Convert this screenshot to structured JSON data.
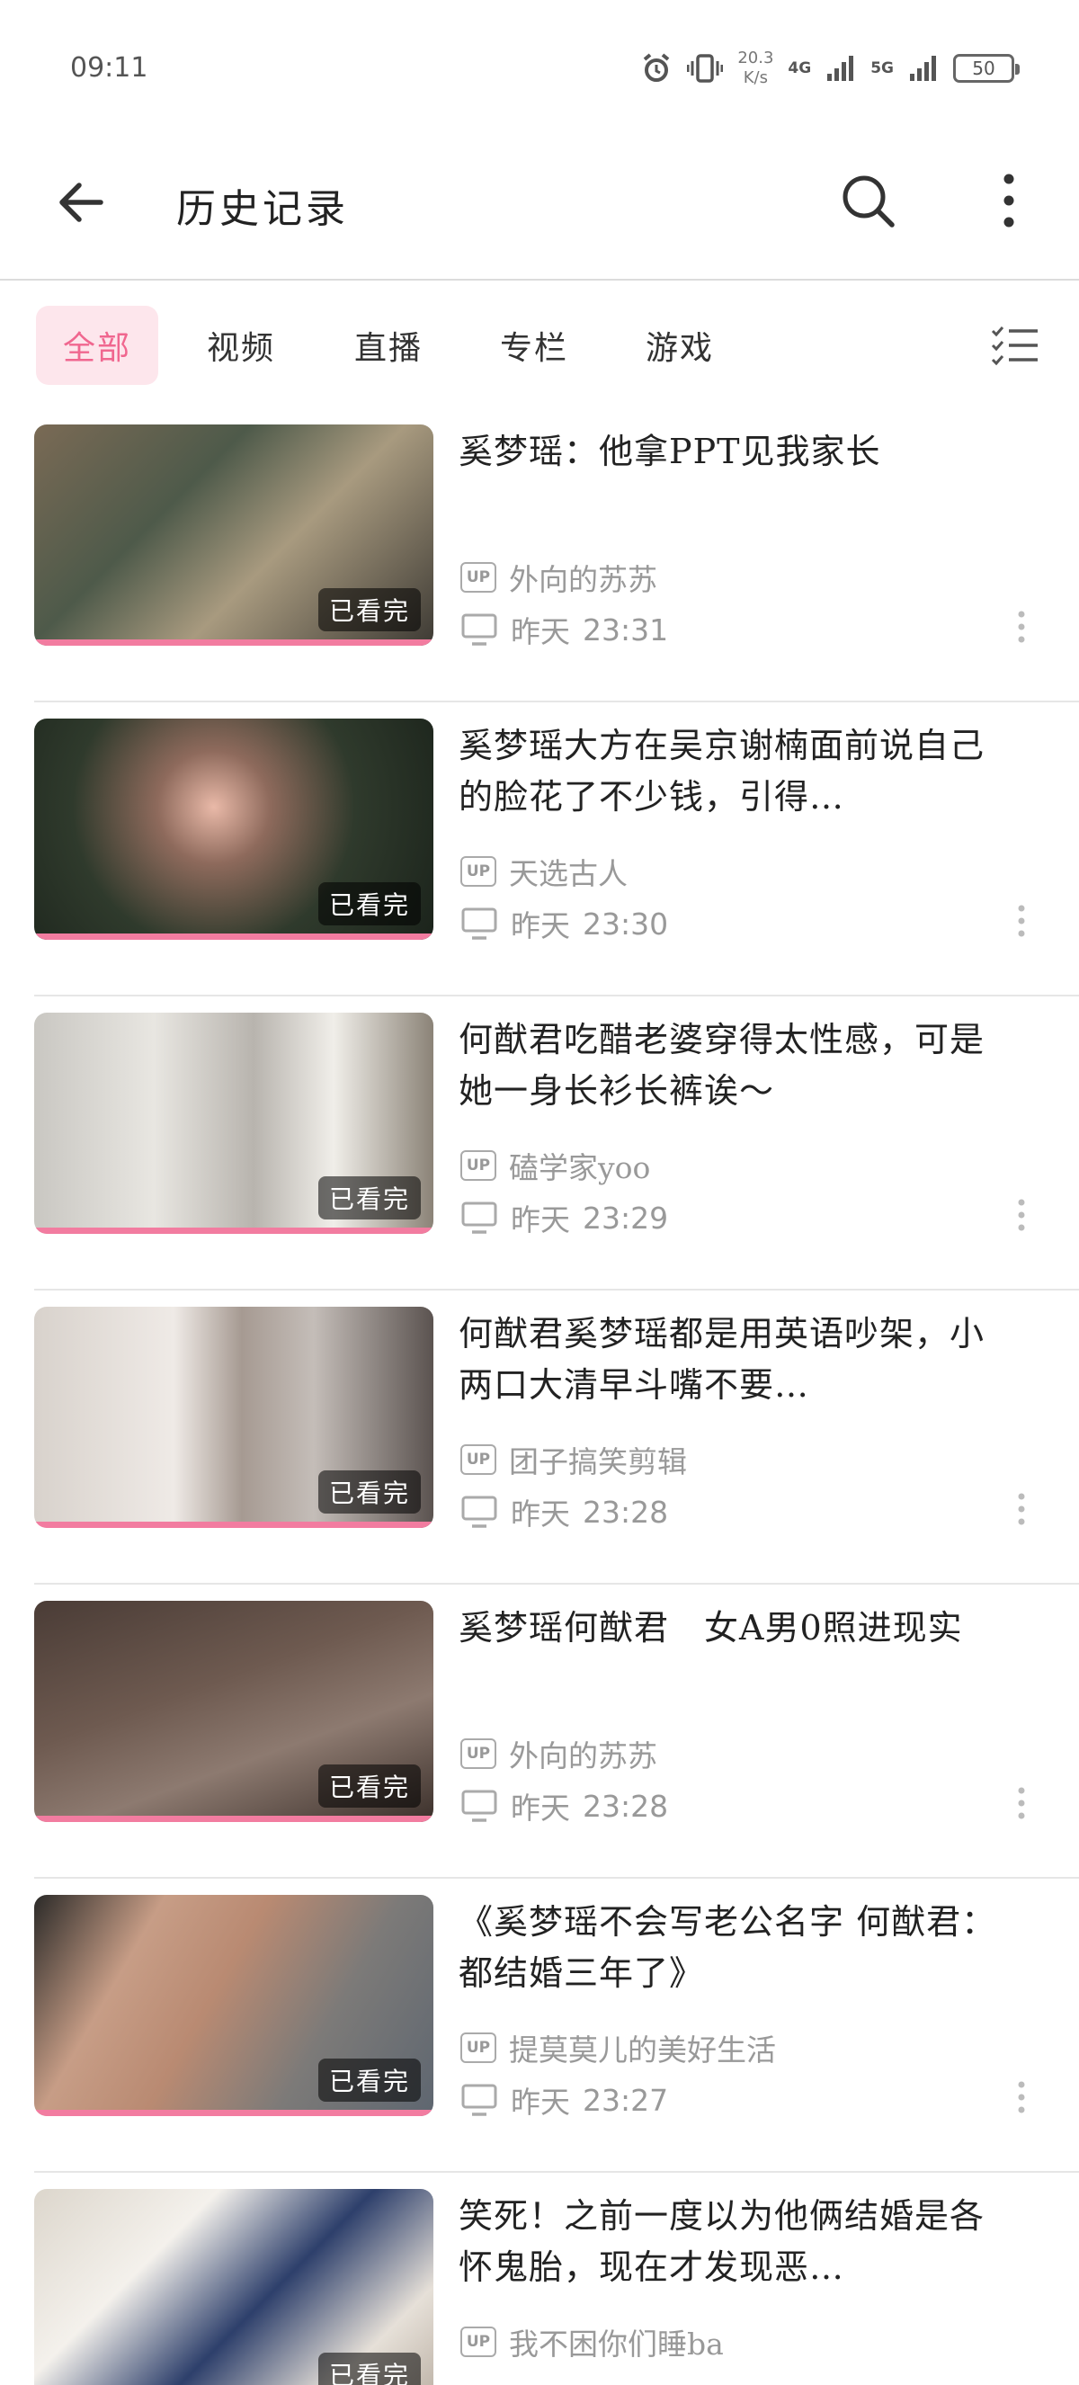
{
  "status_bar": {
    "time": "09:11",
    "net_speed_value": "20.3",
    "net_speed_unit": "K/s",
    "signal_1": "4G",
    "signal_2": "5G",
    "battery": "50"
  },
  "header": {
    "title": "历史记录",
    "back_icon": "arrow-left-icon",
    "search_icon": "search-icon",
    "more_icon": "more-vertical-icon"
  },
  "tabs": [
    {
      "label": "全部",
      "active": true
    },
    {
      "label": "视频",
      "active": false
    },
    {
      "label": "直播",
      "active": false
    },
    {
      "label": "专栏",
      "active": false
    },
    {
      "label": "游戏",
      "active": false
    }
  ],
  "list_edit_icon": "checklist-icon",
  "colors": {
    "accent": "#f0678f",
    "accent_bg": "#fde6ec",
    "progress": "#f27ca0"
  },
  "videos": [
    {
      "title": "奚梦瑶：他拿PPT见我家长",
      "uploader": "外向的苏苏",
      "day": "昨天",
      "time": "23:31",
      "status": "已看完"
    },
    {
      "title": "奚梦瑶大方在吴京谢楠面前说自己的脸花了不少钱，引得…",
      "uploader": "天选古人",
      "day": "昨天",
      "time": "23:30",
      "status": "已看完"
    },
    {
      "title": "何猷君吃醋老婆穿得太性感，可是她一身长衫长裤诶～",
      "uploader": "磕学家yoo",
      "day": "昨天",
      "time": "23:29",
      "status": "已看完"
    },
    {
      "title": "何猷君奚梦瑶都是用英语吵架，小两口大清早斗嘴不要…",
      "uploader": "团子搞笑剪辑",
      "day": "昨天",
      "time": "23:28",
      "status": "已看完"
    },
    {
      "title": "奚梦瑶何猷君　女A男0照进现实",
      "uploader": "外向的苏苏",
      "day": "昨天",
      "time": "23:28",
      "status": "已看完"
    },
    {
      "title": "《奚梦瑶不会写老公名字 何猷君：都结婚三年了》",
      "uploader": "提莫莫儿的美好生活",
      "day": "昨天",
      "time": "23:27",
      "status": "已看完"
    },
    {
      "title": "笑死！之前一度以为他俩结婚是各怀鬼胎，现在才发现恶…",
      "uploader": "我不困你们睡ba",
      "day": "",
      "time": "",
      "status": "已看完"
    }
  ],
  "up_badge": "UP"
}
